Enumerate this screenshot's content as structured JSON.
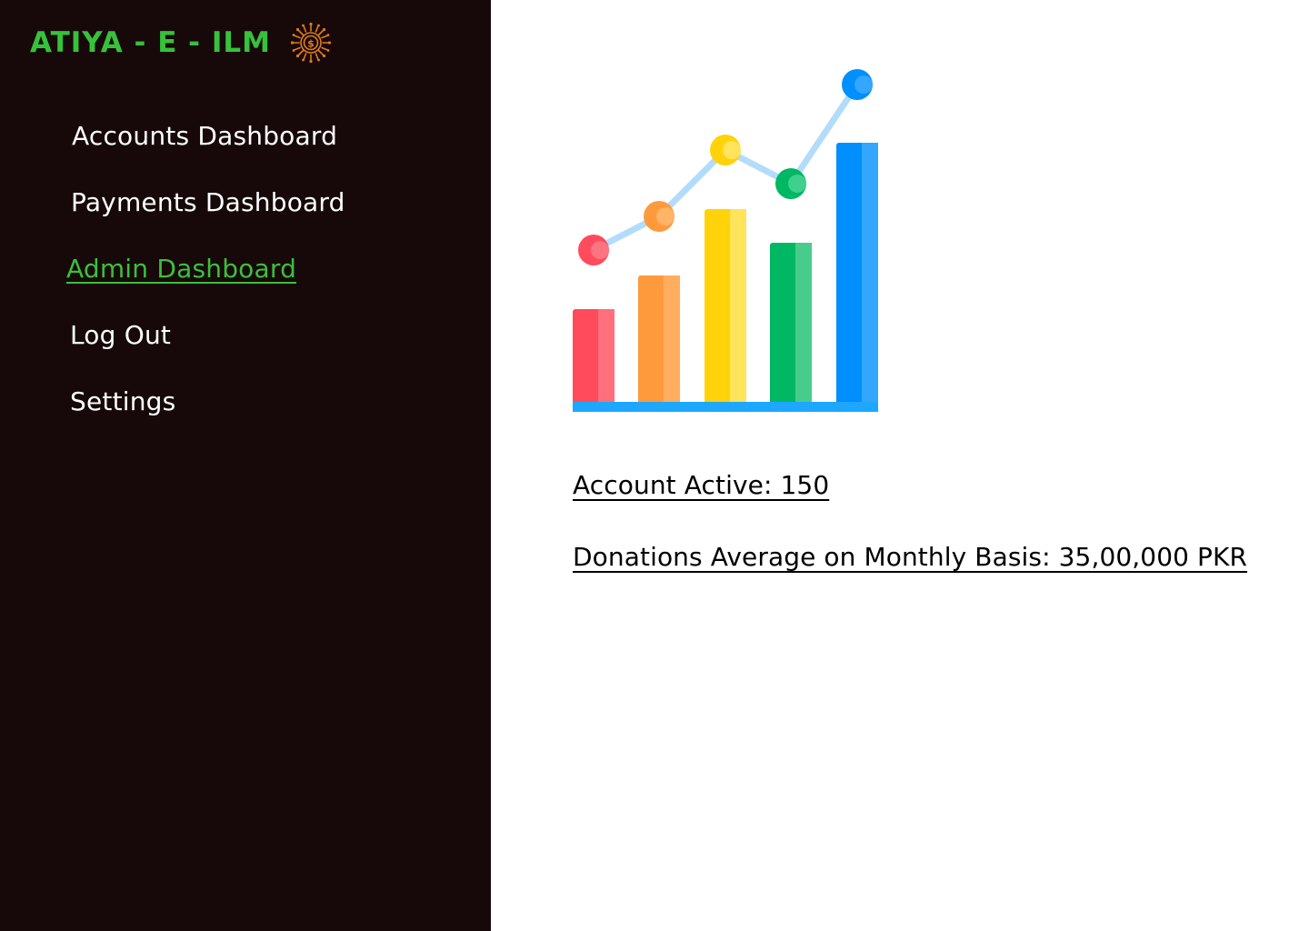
{
  "brand": {
    "title": "ATIYA - E - ILM",
    "logo_icon": "donation-coin-icon",
    "title_color": "#36c23a",
    "logo_color": "#e07b1f"
  },
  "sidebar": {
    "background": "#170909",
    "items": [
      {
        "label": "Accounts Dashboard",
        "active": false
      },
      {
        "label": "Payments Dashboard",
        "active": false
      },
      {
        "label": "Admin Dashboard",
        "active": true
      },
      {
        "label": "Log Out",
        "active": false
      },
      {
        "label": "Settings",
        "active": false
      }
    ]
  },
  "main": {
    "illustration_icon": "growth-bar-chart-icon",
    "stats": {
      "accounts_active": "Account Active: 150",
      "donations_average": "Donations Average on Monthly Basis: 35,00,000 PKR"
    }
  }
}
